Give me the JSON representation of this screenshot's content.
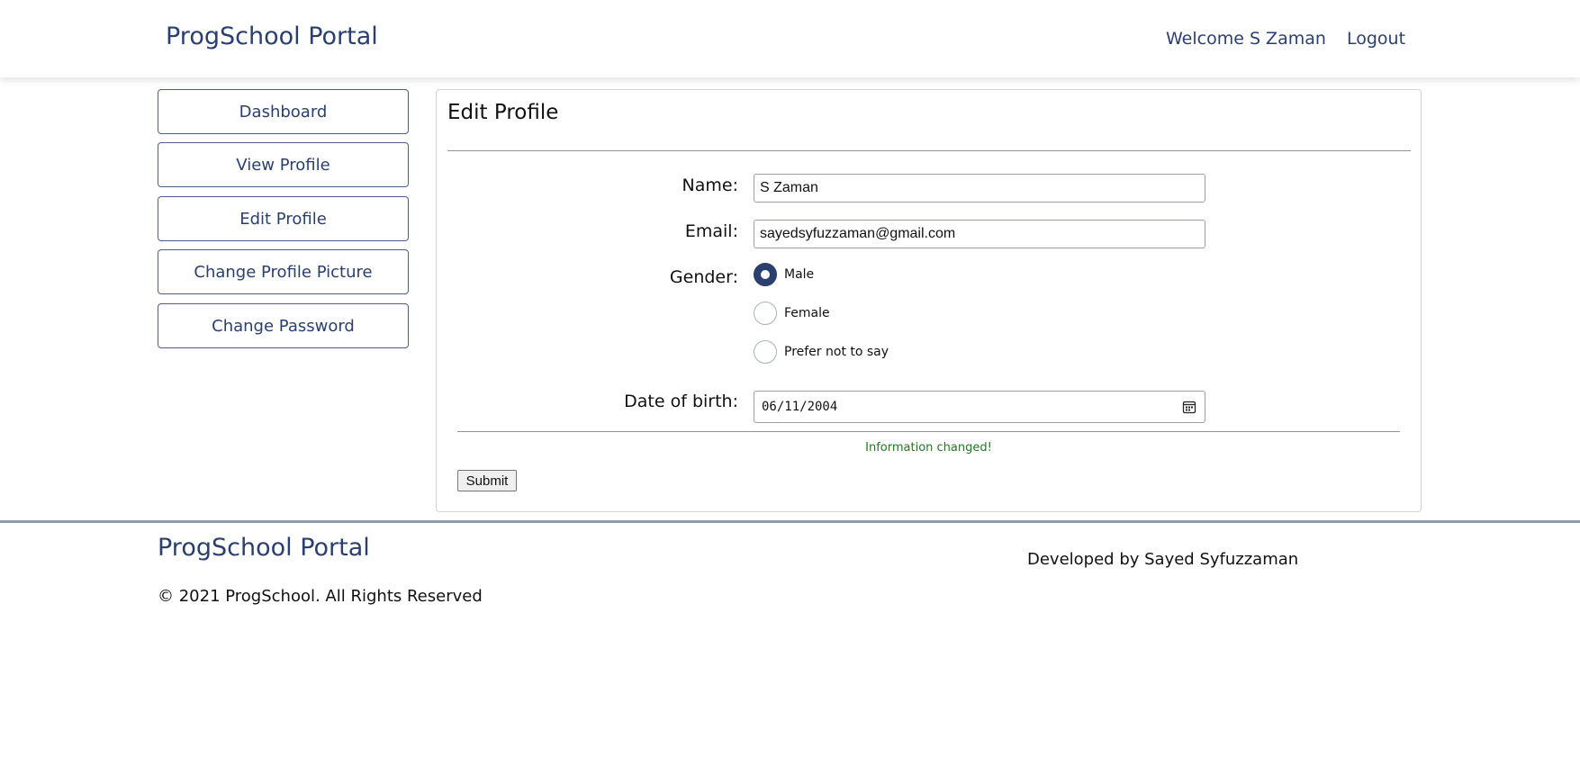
{
  "header": {
    "brand": "ProgSchool Portal",
    "welcome": "Welcome S Zaman",
    "logout": "Logout"
  },
  "sidebar": {
    "items": [
      {
        "label": "Dashboard"
      },
      {
        "label": "View Profile"
      },
      {
        "label": "Edit Profile"
      },
      {
        "label": "Change Profile Picture"
      },
      {
        "label": "Change Password"
      }
    ]
  },
  "form": {
    "title": "Edit Profile",
    "name_label": "Name:",
    "name_value": "S Zaman",
    "email_label": "Email:",
    "email_value": "sayedsyfuzzaman@gmail.com",
    "gender_label": "Gender:",
    "gender_options": [
      {
        "label": "Male",
        "selected": true
      },
      {
        "label": "Female",
        "selected": false
      },
      {
        "label": "Prefer not to say",
        "selected": false
      }
    ],
    "dob_label": "Date of birth:",
    "dob_value": "06/11/2004",
    "calendar_icon": "calendar-icon",
    "status_message": "Information changed!",
    "submit_label": "Submit"
  },
  "footer": {
    "brand": "ProgSchool Portal",
    "copyright": "© 2021 ProgSchool. All Rights Reserved",
    "developer": "Developed by Sayed Syfuzzaman"
  },
  "colors": {
    "brand": "#2b3f6e",
    "success": "#1f7a1f"
  }
}
